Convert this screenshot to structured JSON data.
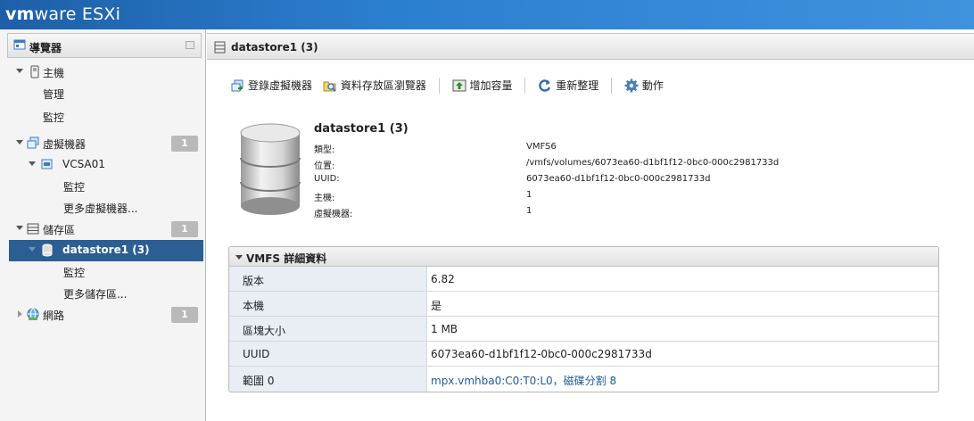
{
  "header": {
    "brand_vm": "vm",
    "brand_ware": "ware",
    "brand_product": " ESXi"
  },
  "navigator": {
    "title": "導覽器",
    "items": [
      {
        "label": "主機"
      },
      {
        "label": "管理"
      },
      {
        "label": "監控"
      },
      {
        "label": "虛擬機器",
        "badge": "1"
      },
      {
        "label": "VCSA01"
      },
      {
        "label": "監控"
      },
      {
        "label": "更多虛擬機器..."
      },
      {
        "label": "儲存區",
        "badge": "1"
      },
      {
        "label": "datastore1 (3)"
      },
      {
        "label": "監控"
      },
      {
        "label": "更多儲存區..."
      },
      {
        "label": "網路",
        "badge": "1"
      }
    ]
  },
  "main": {
    "title": "datastore1 (3)",
    "toolbar": {
      "register_vm": "登錄虛擬機器",
      "datastore_browser": "資料存放區瀏覽器",
      "increase_capacity": "增加容量",
      "refresh": "重新整理",
      "actions": "動作"
    },
    "summary": {
      "name": "datastore1 (3)",
      "rows": [
        {
          "key": "類型:",
          "value": "VMFS6"
        },
        {
          "key": "位置:",
          "value": "/vmfs/volumes/6073ea60-d1bf1f12-0bc0-000c2981733d"
        },
        {
          "key": "UUID:",
          "value": "6073ea60-d1bf1f12-0bc0-000c2981733d"
        },
        {
          "key": "主機:",
          "value": "1"
        },
        {
          "key": "虛擬機器:",
          "value": "1"
        }
      ]
    },
    "vmfs": {
      "title": "VMFS 詳細資料",
      "rows": [
        {
          "key": "版本",
          "value": "6.82"
        },
        {
          "key": "本機",
          "value": "是"
        },
        {
          "key": "區塊大小",
          "value": "1 MB"
        },
        {
          "key": "UUID",
          "value": "6073ea60-d1bf1f12-0bc0-000c2981733d"
        },
        {
          "key": "範圍 0",
          "value": "mpx.vmhba0:C0:T0:L0，磁碟分割 8"
        }
      ]
    }
  }
}
